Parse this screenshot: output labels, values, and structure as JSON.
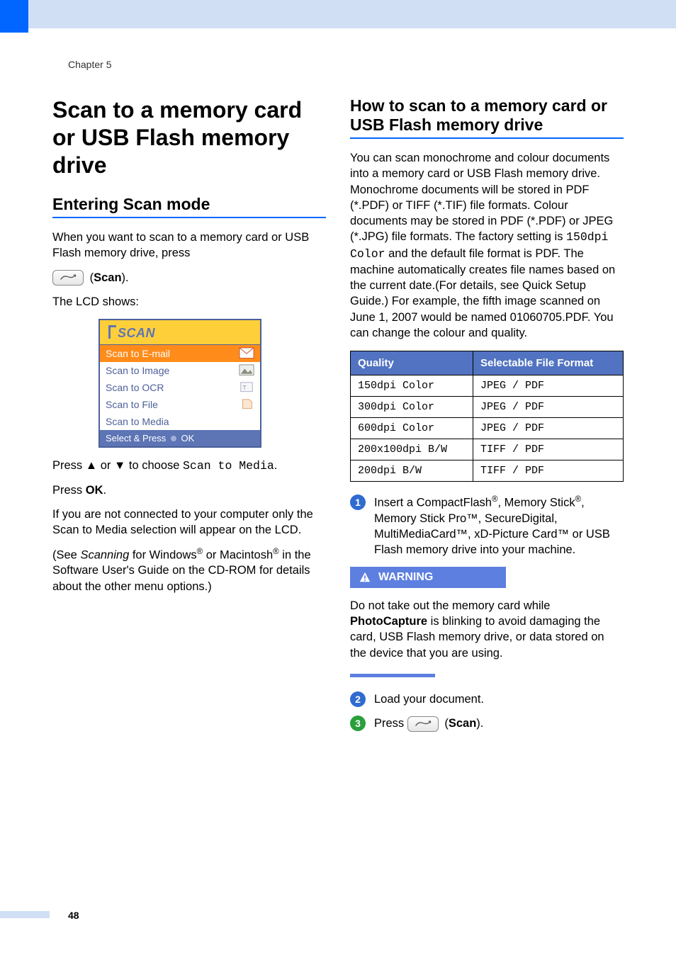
{
  "chapter_label": "Chapter 5",
  "page_number": "48",
  "left": {
    "h1": "Scan to a  memory card or USB Flash memory drive",
    "h2": "Entering Scan mode",
    "p1_a": "When you want to scan to a memory card or USB Flash memory drive, press",
    "scan_label": "Scan",
    "p2": "The LCD shows:",
    "lcd": {
      "title": "SCAN",
      "selected": "Scan to E-mail",
      "items": [
        "Scan to Image",
        "Scan to OCR",
        "Scan to File",
        "Scan to Media"
      ],
      "footer_a": "Select & Press",
      "footer_b": "OK"
    },
    "p3_a": "Press ",
    "p3_b": " or ",
    "p3_c": " to choose ",
    "p3_code": "Scan to Media",
    "p4_a": "Press ",
    "p4_b": "OK",
    "p5": "If you are not connected to your computer only the Scan to Media selection will appear on the LCD.",
    "p6_a": "(See ",
    "p6_i": "Scanning",
    "p6_b": " for Windows",
    "p6_c": " or Macintosh",
    "p6_d": " in the Software User's Guide on the CD-ROM for details about the other menu options.)"
  },
  "right": {
    "h2": "How to scan to a memory card or USB Flash memory drive",
    "p1_a": "You can scan monochrome and colour documents into a memory card or USB Flash memory drive. Monochrome documents will be stored in PDF (*.PDF) or TIFF (*.TIF) file formats. Colour documents may be stored in PDF (*.PDF) or JPEG (*.JPG) file formats. The factory setting is ",
    "p1_code": "150dpi Color",
    "p1_b": " and the default file format is PDF. The machine automatically creates file names based on the current date.(For details, see Quick Setup Guide.) For example, the fifth image scanned on June 1, 2007 would be named 01060705.PDF. You can change the colour and quality.",
    "table": {
      "head": [
        "Quality",
        "Selectable File Format"
      ],
      "rows": [
        [
          "150dpi Color",
          "JPEG / PDF"
        ],
        [
          "300dpi Color",
          "JPEG / PDF"
        ],
        [
          "600dpi Color",
          "JPEG / PDF"
        ],
        [
          "200x100dpi B/W",
          "TIFF / PDF"
        ],
        [
          "200dpi B/W",
          "TIFF / PDF"
        ]
      ]
    },
    "step1_a": "Insert a CompactFlash",
    "step1_b": ", Memory Stick",
    "step1_c": ", Memory Stick Pro™, SecureDigital, MultiMediaCard™, xD-Picture Card™ or USB Flash memory drive into your machine.",
    "warning_label": "WARNING",
    "warning_a": "Do not take out the memory card while ",
    "warning_b": "PhotoCapture",
    "warning_c": " is blinking to avoid damaging the card, USB Flash memory drive, or data stored on the device that you are using.",
    "step2": "Load your document.",
    "step3_a": "Press ",
    "step3_b": "Scan",
    "step3_c": ")."
  },
  "icons": {
    "up_arrow": "▲",
    "down_arrow": "▼",
    "reg": "®"
  }
}
